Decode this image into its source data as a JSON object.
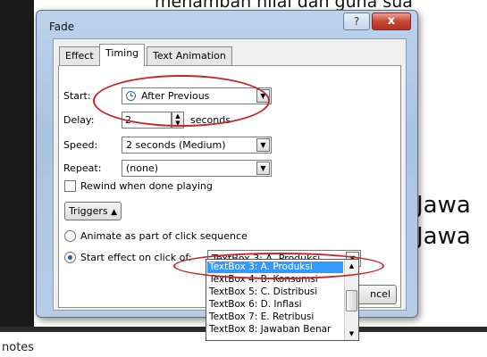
{
  "slide": {
    "top_text": "menambah nilai dan guna sua",
    "big_line_1": "Jawa",
    "big_line_2": "Jawa",
    "notes_label": "notes"
  },
  "dialog": {
    "title": "Fade",
    "help_label": "?",
    "close_label": "x",
    "tabs": [
      {
        "label": "Effect",
        "active": false
      },
      {
        "label": "Timing",
        "active": true
      },
      {
        "label": "Text Animation",
        "active": false
      }
    ],
    "timing": {
      "start_label": "Start:",
      "start_value": "After Previous",
      "delay_label": "Delay:",
      "delay_value": "2",
      "delay_unit": "seconds",
      "speed_label": "Speed:",
      "speed_value": "2 seconds (Medium)",
      "repeat_label": "Repeat:",
      "repeat_value": "(none)",
      "rewind_label": "Rewind when done playing",
      "rewind_checked": false,
      "triggers_label": "Triggers",
      "animate_label": "Animate as part of click sequence",
      "start_on_click_label": "Start effect on click of:",
      "start_on_click_value": "TextBox 3: A. Produksi",
      "cancel_label": "ncel"
    },
    "dropdown_items": [
      "TextBox 3: A. Produksi",
      "TextBox 4: B. Konsumsi",
      "TextBox 5: C. Distribusi",
      "TextBox 6: D. Inflasi",
      "TextBox 7: E. Retribusi",
      "TextBox 8: Jawaban Benar"
    ],
    "selected_index": 0
  },
  "colors": {
    "highlight_ellipse": "#c3272b",
    "selection": "#3399ff"
  }
}
